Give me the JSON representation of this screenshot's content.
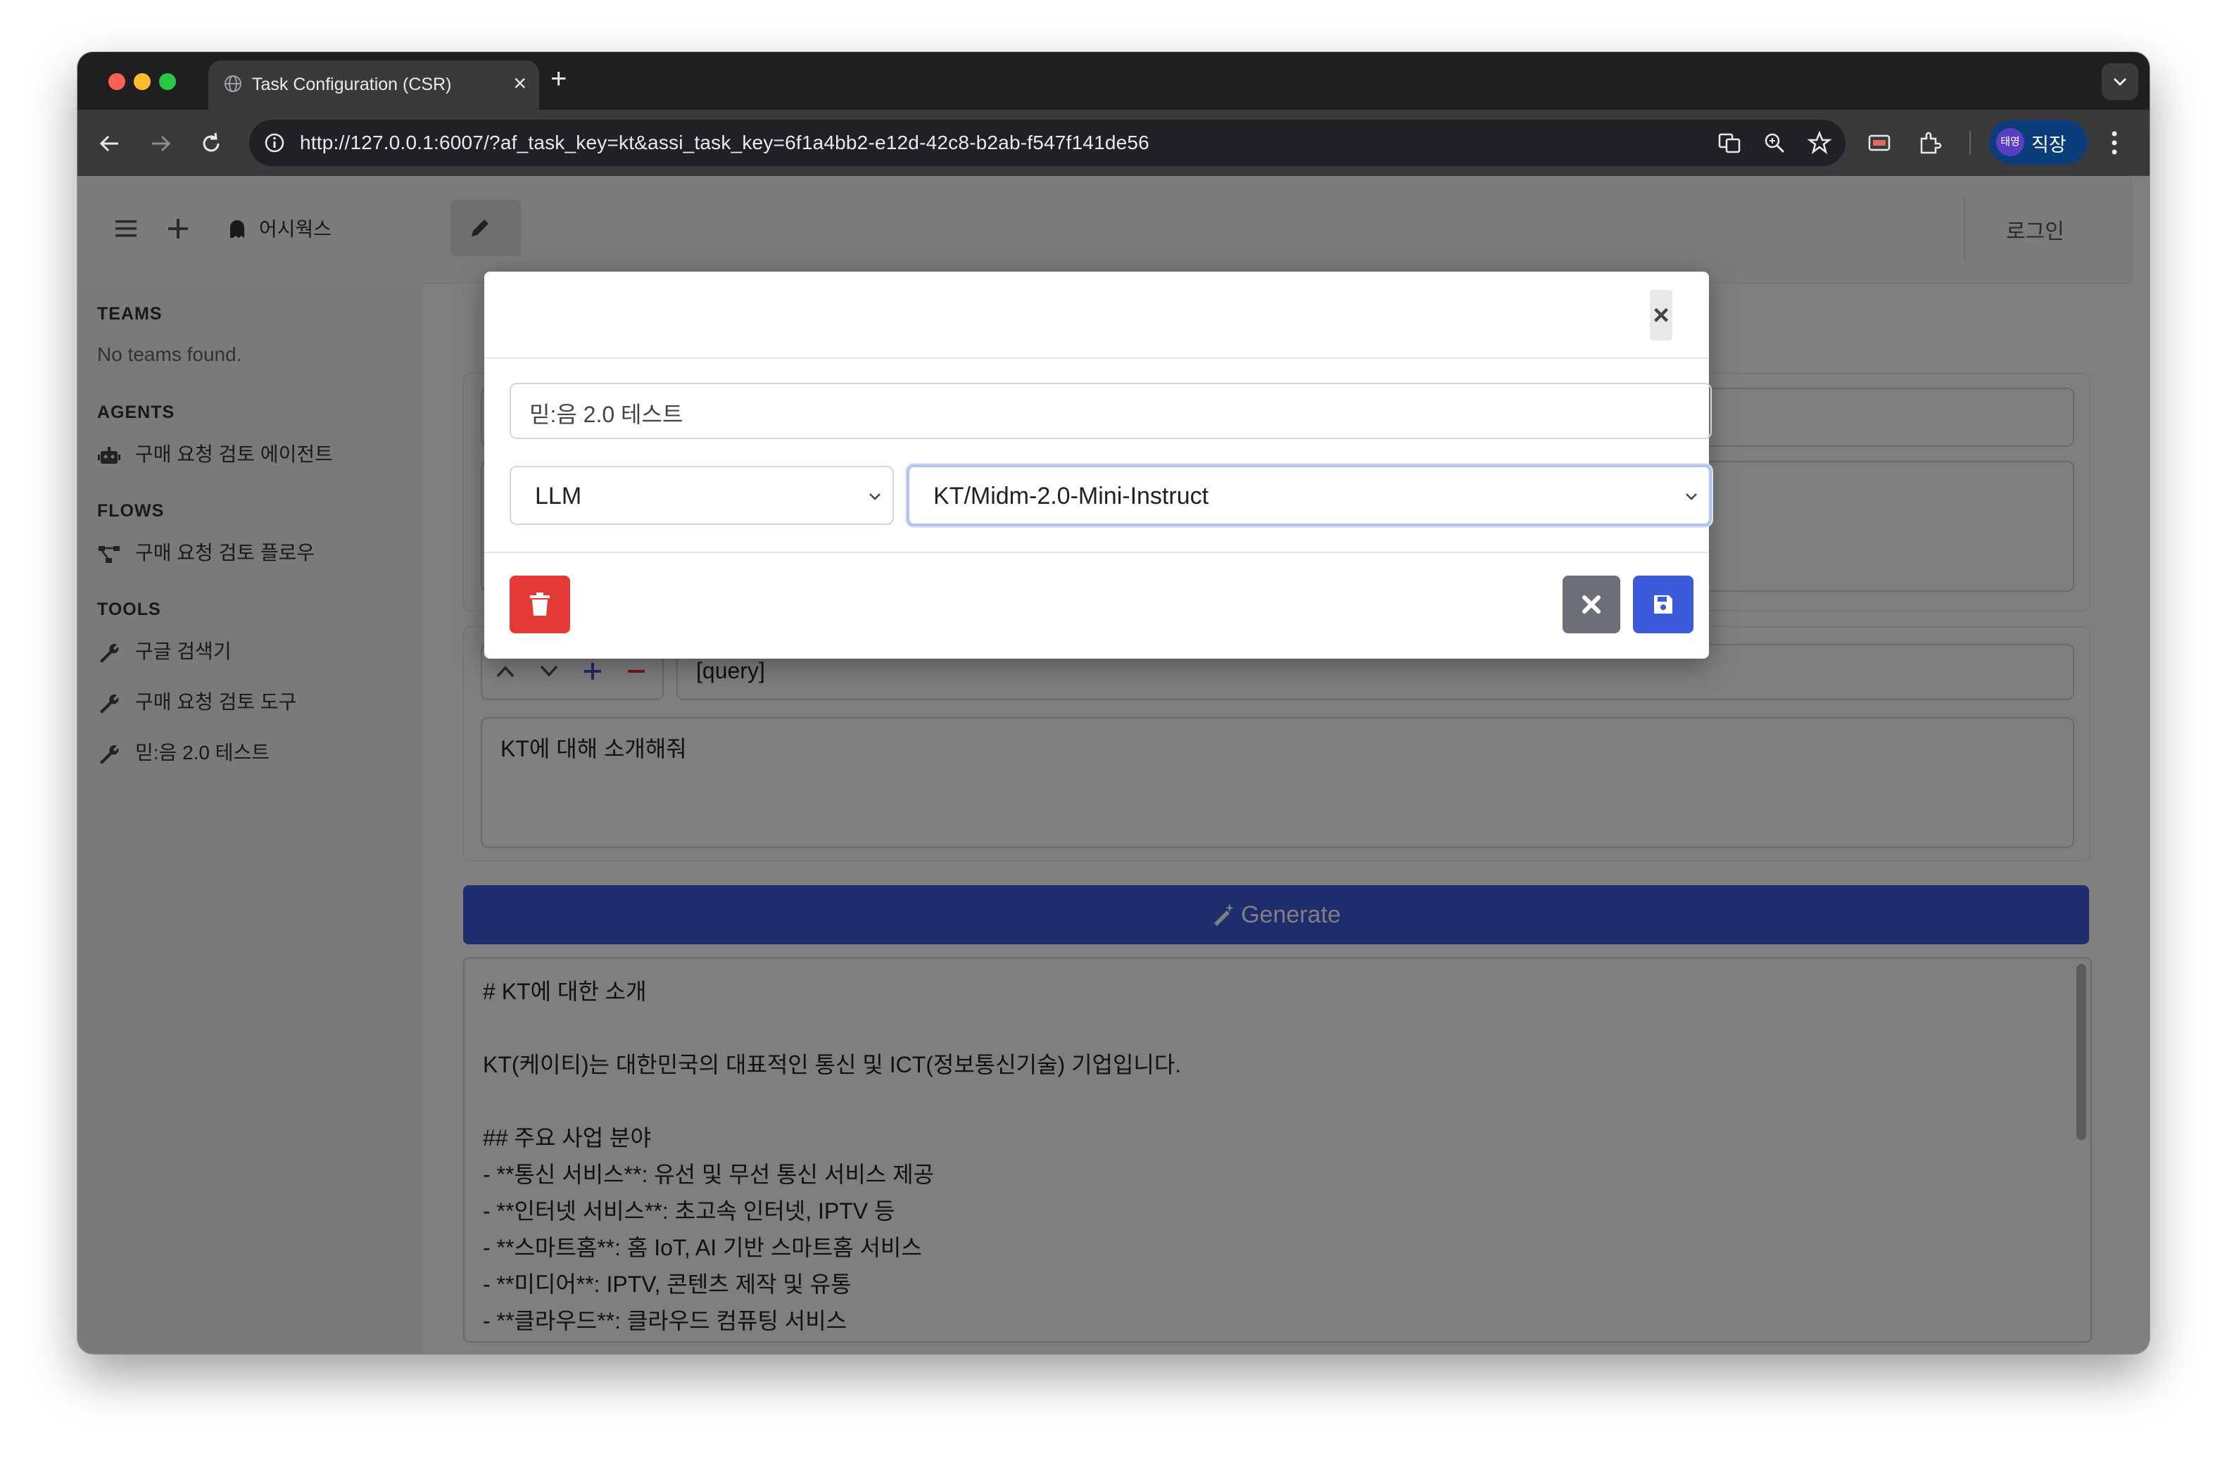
{
  "browser": {
    "tab_title": "Task Configuration (CSR)",
    "tab_close": "×",
    "new_tab": "+",
    "url": "http://127.0.0.1:6007/?af_task_key=kt&assi_task_key=6f1a4bb2-e12d-42c8-b2ab-f547f141de56",
    "profile_avatar": "태영",
    "profile_name": "직장"
  },
  "header": {
    "brand": "어시웍스",
    "login": "로그인"
  },
  "sidebar": {
    "teams_heading": "TEAMS",
    "teams_empty": "No teams found.",
    "agents_heading": "AGENTS",
    "agents": [
      "구매 요청 검토 에이전트"
    ],
    "flows_heading": "FLOWS",
    "flows": [
      "구매 요청 검토 플로우"
    ],
    "tools_heading": "TOOLS",
    "tools": [
      "구글 검색기",
      "구매 요청 검토 도구",
      "믿:음 2.0 테스트"
    ]
  },
  "main": {
    "param_value": "[query]",
    "prompt_text": "KT에 대해 소개해줘",
    "generate_label": "Generate",
    "output_lines": [
      "# KT에 대한 소개",
      "",
      "KT(케이티)는 대한민국의 대표적인 통신 및 ICT(정보통신기술) 기업입니다.",
      "",
      "## 주요 사업 분야",
      "- **통신 서비스**: 유선 및 무선 통신 서비스 제공",
      "- **인터넷 서비스**: 초고속 인터넷, IPTV 등",
      "- **스마트홈**: 홈 IoT, AI 기반 스마트홈 서비스",
      "- **미디어**: IPTV, 콘텐츠 제작 및 유통",
      "- **클라우드**: 클라우드 컴퓨팅 서비스"
    ]
  },
  "modal": {
    "close_label": "×",
    "title_value": "믿:음 2.0 테스트",
    "type_value": "LLM",
    "model_value": "KT/Midm-2.0-Mini-Instruct"
  },
  "colors": {
    "primary": "#3b5bdb",
    "danger": "#e53935",
    "secondary": "#6c6f7a"
  }
}
